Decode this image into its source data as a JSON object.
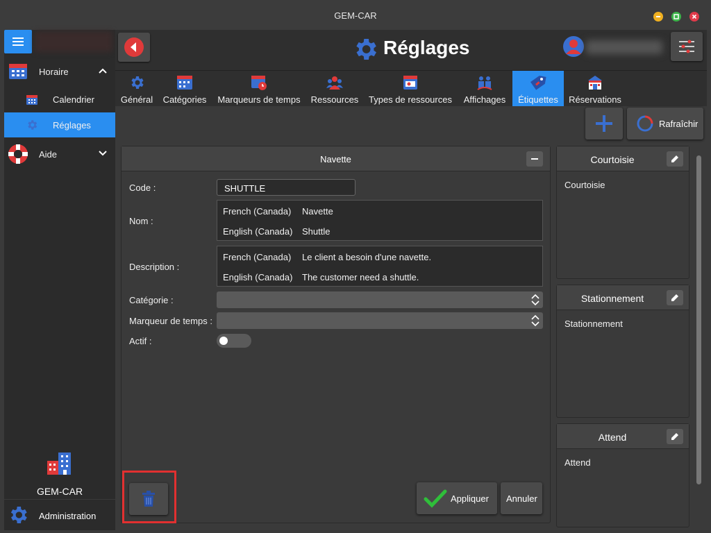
{
  "window": {
    "title": "GEM-CAR"
  },
  "sidebar": {
    "items": [
      {
        "label": "Horaire"
      },
      {
        "label": "Calendrier"
      },
      {
        "label": "Réglages"
      },
      {
        "label": "Aide"
      }
    ],
    "brand": "GEM-CAR",
    "admin": "Administration"
  },
  "header": {
    "title": "Réglages"
  },
  "tabs": [
    {
      "label": "Général"
    },
    {
      "label": "Catégories"
    },
    {
      "label": "Marqueurs de temps"
    },
    {
      "label": "Ressources"
    },
    {
      "label": "Types de ressources"
    },
    {
      "label": "Affichages"
    },
    {
      "label": "Étiquettes"
    },
    {
      "label": "Réservations"
    }
  ],
  "actions": {
    "refresh": "Rafraîchir"
  },
  "form": {
    "title": "Navette",
    "code_label": "Code :",
    "code_value": "SHUTTLE",
    "name_label": "Nom :",
    "name": [
      {
        "lang": "French (Canada)",
        "value": "Navette"
      },
      {
        "lang": "English (Canada)",
        "value": "Shuttle"
      }
    ],
    "description_label": "Description :",
    "description": [
      {
        "lang": "French (Canada)",
        "value": "Le client a besoin d'une navette."
      },
      {
        "lang": "English (Canada)",
        "value": "The customer need a shuttle."
      }
    ],
    "category_label": "Catégorie :",
    "category_value": "",
    "marker_label": "Marqueur de temps :",
    "marker_value": "",
    "active_label": "Actif :",
    "active": false,
    "apply": "Appliquer",
    "cancel": "Annuler"
  },
  "cards": [
    {
      "title": "Courtoisie",
      "body": "Courtoisie"
    },
    {
      "title": "Stationnement",
      "body": "Stationnement"
    },
    {
      "title": "Attend",
      "body": "Attend"
    }
  ],
  "colors": {
    "accent": "#2a8ef0",
    "highlight": "#e23030",
    "back": "#e03a3a",
    "icon_blue": "#3a6fd0"
  }
}
